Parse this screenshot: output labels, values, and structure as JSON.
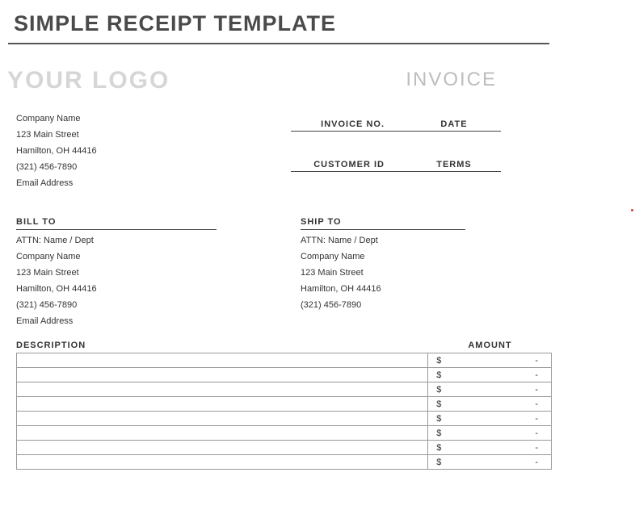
{
  "title": "SIMPLE RECEIPT TEMPLATE",
  "header": {
    "logo": "YOUR LOGO",
    "doc_label": "INVOICE"
  },
  "company": {
    "name": "Company Name",
    "street": "123 Main Street",
    "city": "Hamilton, OH  44416",
    "phone": "(321) 456-7890",
    "email": "Email Address"
  },
  "meta": {
    "invoice_no_label": "INVOICE NO.",
    "date_label": "DATE",
    "customer_id_label": "CUSTOMER ID",
    "terms_label": "TERMS"
  },
  "bill_to": {
    "heading": "BILL TO",
    "attn": "ATTN: Name / Dept",
    "company": "Company Name",
    "street": "123 Main Street",
    "city": "Hamilton, OH  44416",
    "phone": "(321) 456-7890",
    "email": "Email Address"
  },
  "ship_to": {
    "heading": "SHIP TO",
    "attn": "ATTN: Name / Dept",
    "company": "Company Name",
    "street": "123 Main Street",
    "city": "Hamilton, OH  44416",
    "phone": "(321) 456-7890"
  },
  "table": {
    "description_header": "DESCRIPTION",
    "amount_header": "AMOUNT",
    "currency_symbol": "$",
    "empty_value": "-",
    "rows": [
      {
        "desc": "",
        "amount": "-"
      },
      {
        "desc": "",
        "amount": "-"
      },
      {
        "desc": "",
        "amount": "-"
      },
      {
        "desc": "",
        "amount": "-"
      },
      {
        "desc": "",
        "amount": "-"
      },
      {
        "desc": "",
        "amount": "-"
      },
      {
        "desc": "",
        "amount": "-"
      },
      {
        "desc": "",
        "amount": "-"
      }
    ]
  }
}
